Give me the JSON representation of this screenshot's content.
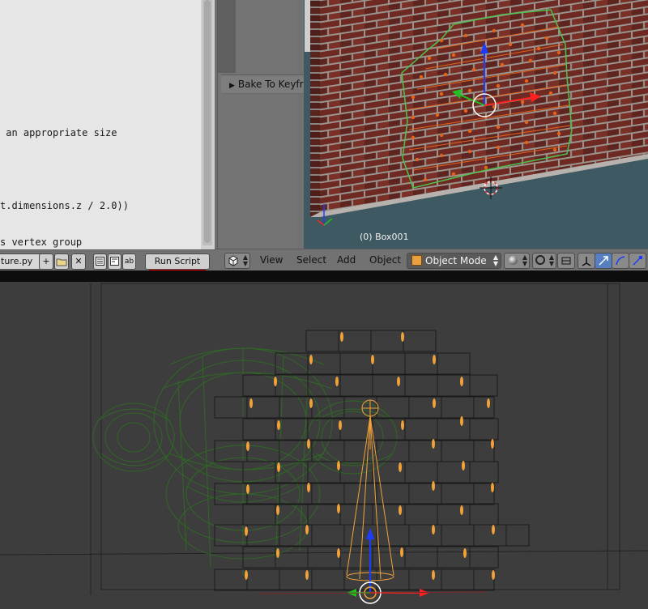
{
  "text_editor": {
    "code_lines": [
      {
        "text": " an appropriate size"
      },
      {
        "text": "t.dimensions.z / 2.0))"
      },
      {
        "text": "s vertex group"
      }
    ],
    "filename": "ture.py",
    "run_script_label": "Run Script"
  },
  "properties": {
    "bake_panel_label": "Bake To Keyfr"
  },
  "viewport_top": {
    "object_label": "(0) Box001"
  },
  "viewport_header": {
    "menus": [
      "View",
      "Select",
      "Add",
      "Object"
    ],
    "mode_label": "Object Mode"
  },
  "colors": {
    "brick": "#6e2a22",
    "mortar": "#a09a94",
    "selection_orange": "#e4631a",
    "selection_green": "#4ec24e",
    "wire_green": "#2f6b24",
    "lamp_orange": "#f2a23a"
  }
}
